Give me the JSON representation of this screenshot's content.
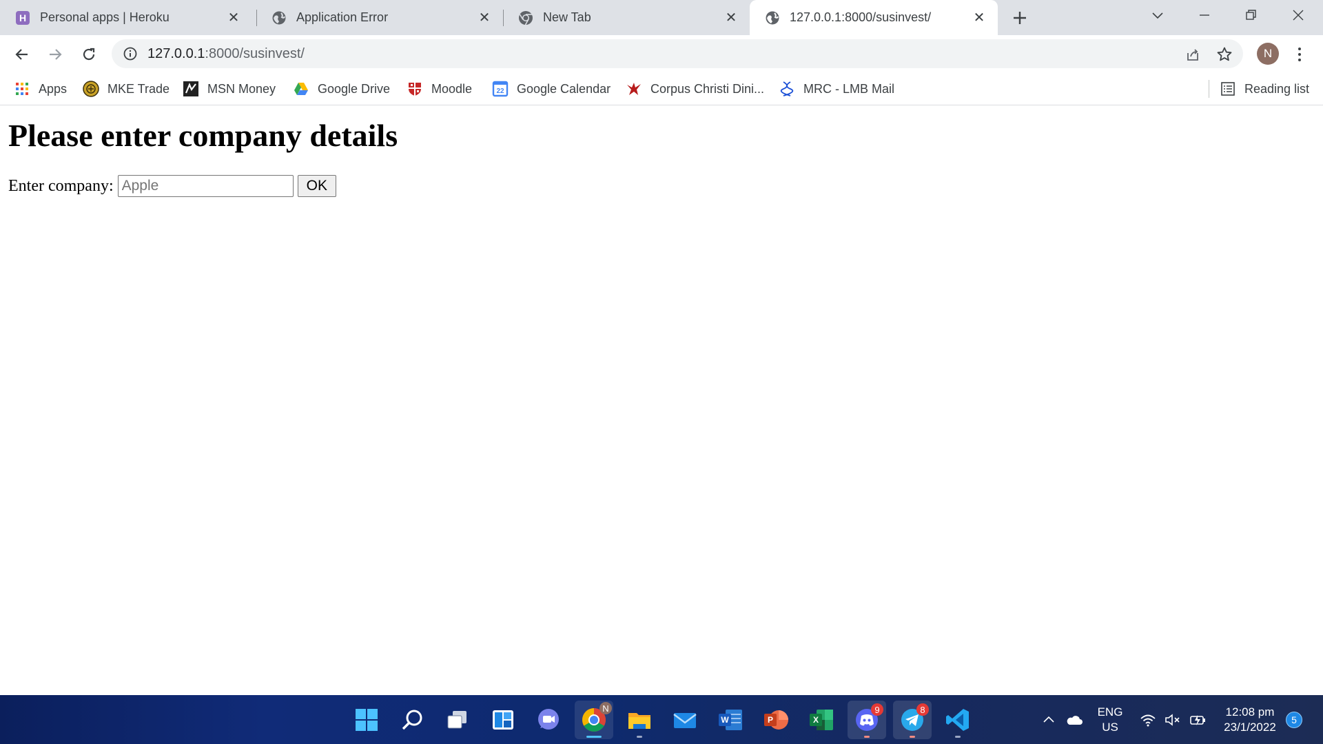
{
  "browser": {
    "tabs": [
      {
        "title": "Personal apps | Heroku",
        "icon": "heroku-icon"
      },
      {
        "title": "Application Error",
        "icon": "globe-icon"
      },
      {
        "title": "New Tab",
        "icon": "chrome-icon"
      },
      {
        "title": "127.0.0.1:8000/susinvest/",
        "icon": "globe-icon",
        "active": true
      }
    ],
    "address": {
      "host": "127.0.0.1",
      "path": ":8000/susinvest/"
    },
    "profile_initial": "N",
    "bookmarks": [
      {
        "label": "Apps",
        "icon": "apps-grid-icon"
      },
      {
        "label": "MKE Trade",
        "icon": "mke-trade-icon"
      },
      {
        "label": "MSN Money",
        "icon": "msn-money-icon"
      },
      {
        "label": "Google Drive",
        "icon": "google-drive-icon"
      },
      {
        "label": "Moodle",
        "icon": "moodle-shield-icon"
      },
      {
        "label": "Google Calendar",
        "icon": "google-calendar-icon",
        "icon_text": "22"
      },
      {
        "label": "Corpus Christi Dini...",
        "icon": "eagle-icon"
      },
      {
        "label": "MRC - LMB Mail",
        "icon": "dna-icon"
      }
    ],
    "reading_list": "Reading list"
  },
  "page": {
    "heading": "Please enter company details",
    "form": {
      "label": "Enter company:",
      "input_value": "",
      "input_placeholder": "Apple",
      "submit_label": "OK"
    }
  },
  "taskbar": {
    "apps": [
      {
        "name": "start",
        "icon": "windows-logo-icon"
      },
      {
        "name": "search",
        "icon": "search-icon"
      },
      {
        "name": "task-view",
        "icon": "task-view-icon"
      },
      {
        "name": "widgets",
        "icon": "widgets-icon"
      },
      {
        "name": "chat",
        "icon": "teams-chat-icon"
      },
      {
        "name": "chrome",
        "icon": "chrome-icon",
        "badge": "N"
      },
      {
        "name": "file-explorer",
        "icon": "folder-icon"
      },
      {
        "name": "mail",
        "icon": "mail-icon"
      },
      {
        "name": "word",
        "icon": "word-icon",
        "letter": "W"
      },
      {
        "name": "powerpoint",
        "icon": "powerpoint-icon",
        "letter": "P"
      },
      {
        "name": "excel",
        "icon": "excel-icon",
        "letter": "X"
      },
      {
        "name": "discord",
        "icon": "discord-icon",
        "badge": "9"
      },
      {
        "name": "telegram",
        "icon": "telegram-icon",
        "badge": "8"
      },
      {
        "name": "vscode",
        "icon": "vscode-icon"
      }
    ],
    "tray": {
      "language_line1": "ENG",
      "language_line2": "US",
      "time": "12:08 pm",
      "date": "23/1/2022",
      "notification_count": "5"
    }
  },
  "colors": {
    "tabstrip_bg": "#dee1e6",
    "omnibox_bg": "#f1f3f4",
    "taskbar_bg": "#102b78",
    "chrome_active_indicator": "#4fc3f7",
    "badge_red": "#e53935"
  }
}
